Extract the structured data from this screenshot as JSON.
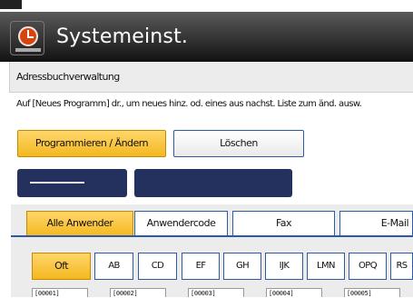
{
  "app": {
    "title": "Systemeinst."
  },
  "breadcrumb": "Adressbuchverwaltung",
  "instruction": "Auf [Neues Programm] dr., um neues hinz. od. eines aus nachst. Liste zum änd. ausw.",
  "toolbar": {
    "program_label": "Programmieren / Ändern",
    "delete_label": "Löschen"
  },
  "tabs": [
    "Alle Anwender",
    "Anwendercode",
    "Fax",
    "E-Mail"
  ],
  "index_keys": [
    "Oft",
    "AB",
    "CD",
    "EF",
    "GH",
    "IJK",
    "LMN",
    "OPQ",
    "RS"
  ],
  "entries": [
    "[00001]",
    "[00002]",
    "[00003]",
    "[00004]",
    "[00005]"
  ],
  "colors": {
    "accent": "#f4b820",
    "border_blue": "#2d5aa6",
    "navy": "#24305e"
  },
  "icons": {
    "app": "settings-clock-icon"
  }
}
